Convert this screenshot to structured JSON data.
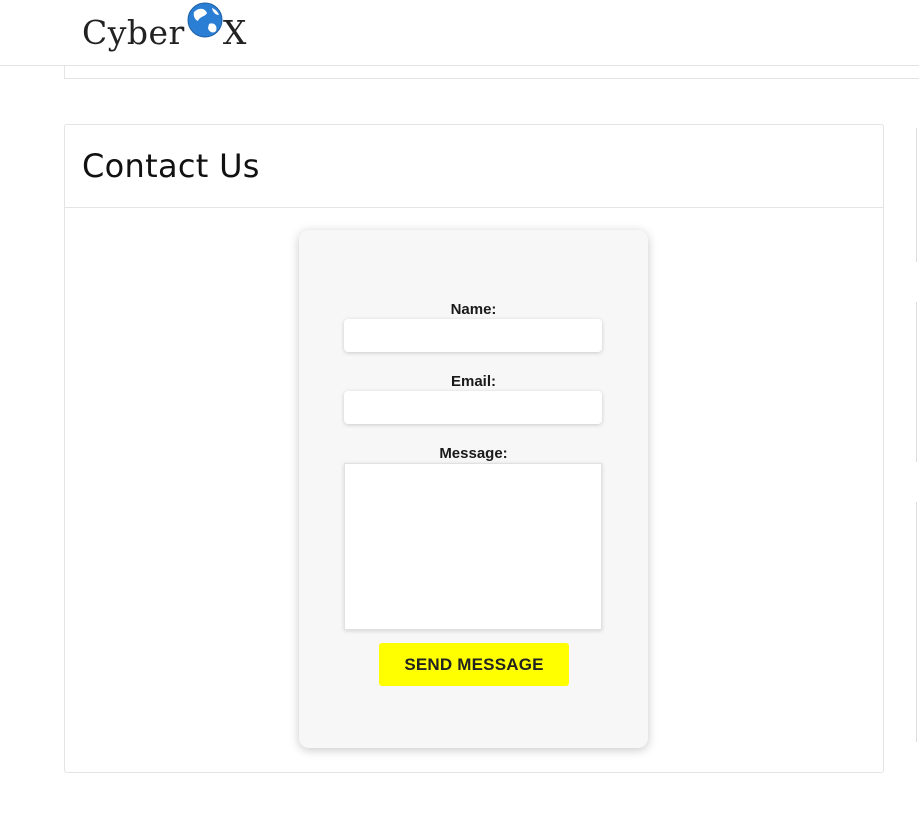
{
  "header": {
    "logo": {
      "text_left": "Cyber",
      "text_right": "X",
      "icon": "globe-icon"
    }
  },
  "contact": {
    "title": "Contact Us",
    "form": {
      "name_label": "Name:",
      "name_value": "",
      "email_label": "Email:",
      "email_value": "",
      "message_label": "Message:",
      "message_value": "",
      "submit_label": "SEND MESSAGE"
    }
  },
  "colors": {
    "button_background": "#ffff00",
    "form_background": "#f7f7f7",
    "globe": "#2a7fd4"
  }
}
